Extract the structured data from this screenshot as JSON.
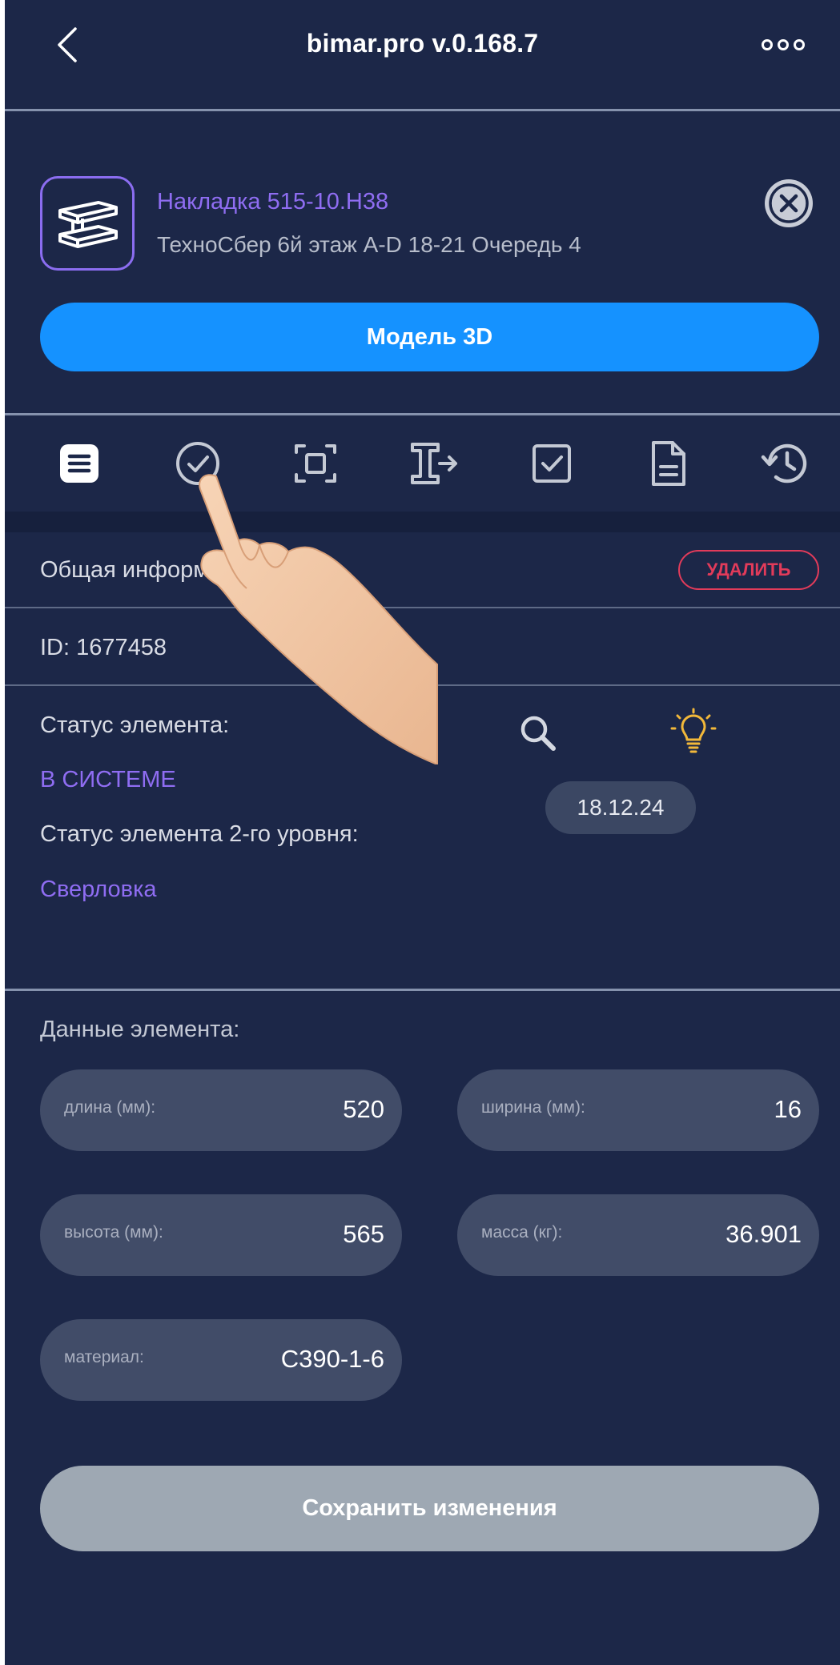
{
  "header": {
    "title": "bimar.pro v.0.168.7"
  },
  "item": {
    "name": "Накладка 515-10.Н38",
    "location": "ТехноСбер 6й этаж A-D 18-21 Очередь 4",
    "model_button": "Модель 3D"
  },
  "tabs": [
    {
      "icon": "list-icon",
      "active": true
    },
    {
      "icon": "check-circle-icon",
      "active": false
    },
    {
      "icon": "frame-icon",
      "active": false
    },
    {
      "icon": "beam-transfer-icon",
      "active": false
    },
    {
      "icon": "checkbox-icon",
      "active": false
    },
    {
      "icon": "document-icon",
      "active": false
    },
    {
      "icon": "history-icon",
      "active": false
    }
  ],
  "general": {
    "title": "Общая информация",
    "delete_label": "УДАЛИТЬ",
    "id_text": "ID: 1677458",
    "status_label": "Статус элемента:",
    "status_value": "В СИСТЕМЕ",
    "status2_label": "Статус элемента 2-го уровня:",
    "status2_value": "Сверловка",
    "date": "18.12.24"
  },
  "element_data": {
    "title": "Данные элемента:",
    "fields": [
      {
        "label": "длина (мм):",
        "value": "520"
      },
      {
        "label": "ширина (мм):",
        "value": "16"
      },
      {
        "label": "высота (мм):",
        "value": "565"
      },
      {
        "label": "масса (кг):",
        "value": "36.901"
      },
      {
        "label": "материал:",
        "value": "С390-1-6"
      }
    ]
  },
  "save_button": "Сохранить изменения",
  "colors": {
    "background": "#1c2748",
    "accent_purple": "#8f6df2",
    "primary_blue": "#1592ff",
    "danger": "#e23b5a",
    "bulb_yellow": "#f2b83a"
  }
}
